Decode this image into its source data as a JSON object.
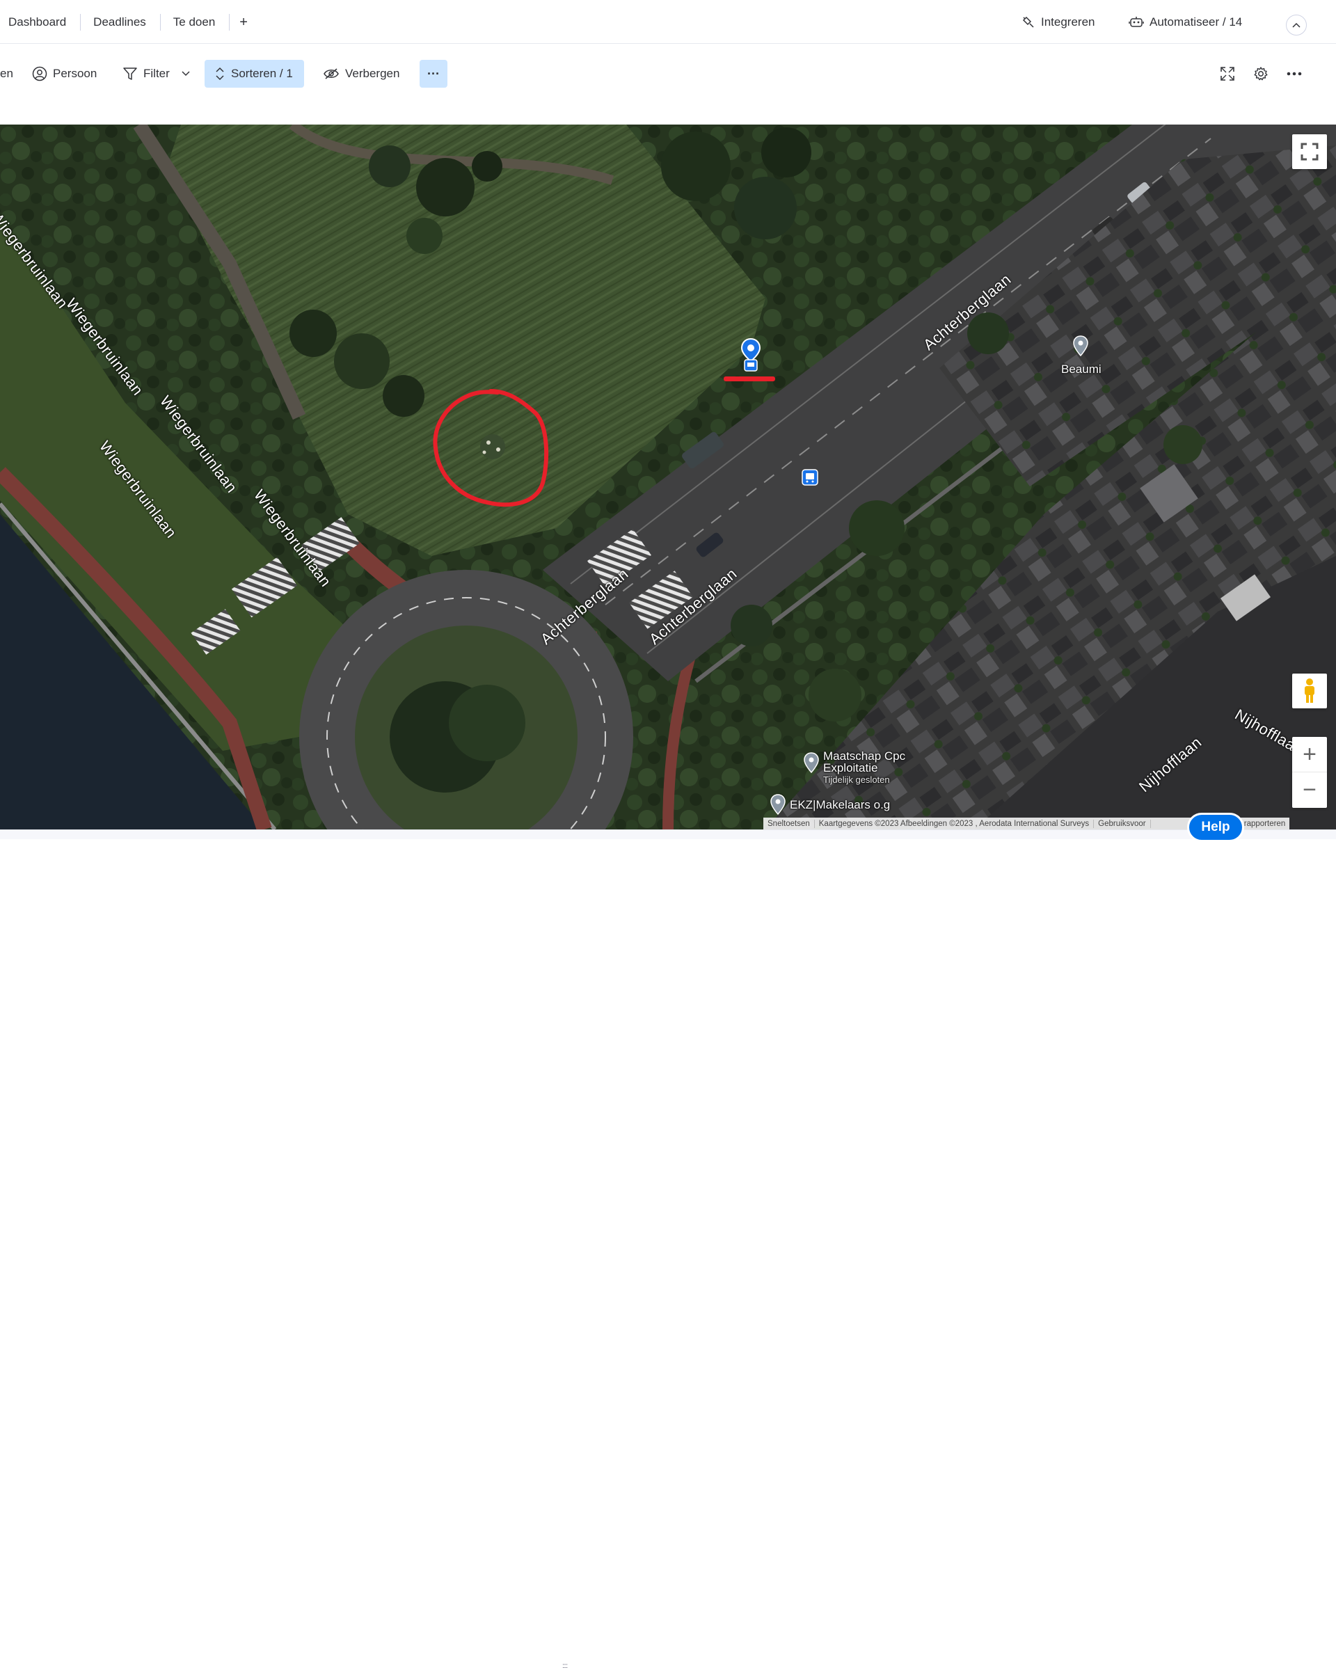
{
  "tabs": {
    "items": [
      "Dashboard",
      "Deadlines",
      "Te doen"
    ],
    "add_label": "+",
    "integrate_label": "Integreren",
    "automate_label": "Automatiseer / 14"
  },
  "toolbar": {
    "cut_label": "en",
    "person_label": "Persoon",
    "filter_label": "Filter",
    "sort_label": "Sorteren / 1",
    "hide_label": "Verbergen",
    "more_label": "···"
  },
  "map": {
    "streets": [
      "Wiegerbruinlaan",
      "Wiegerbruinlaan",
      "Wiegerbruinlaan",
      "Wiegerbruinlaan",
      "Wiegerbruinlaan",
      "Achterberglaan",
      "Achterberglaan",
      "Achterberglaan",
      "Nijhofflaan",
      "Nijhofflaan"
    ],
    "pois": {
      "beaumi": "Beaumi",
      "maatschap_line1": "Maatschap Cpc",
      "maatschap_line2": "Exploitatie",
      "maatschap_status": "Tijdelijk gesloten",
      "ekz": "EKZ|Makelaars o.g"
    },
    "attribution": {
      "shortcuts": "Sneltoetsen",
      "data": "Kaartgegevens ©2023 Afbeeldingen ©2023 , Aerodata International Surveys",
      "terms": "Gebruiksvoor",
      "report": "aartfout rapporteren"
    },
    "zoom_in": "+",
    "zoom_out": "−",
    "annotation_color": "#e8202a",
    "marker_color": "#1a73e8"
  },
  "help_label": "Help",
  "resize_glyph": "::::"
}
